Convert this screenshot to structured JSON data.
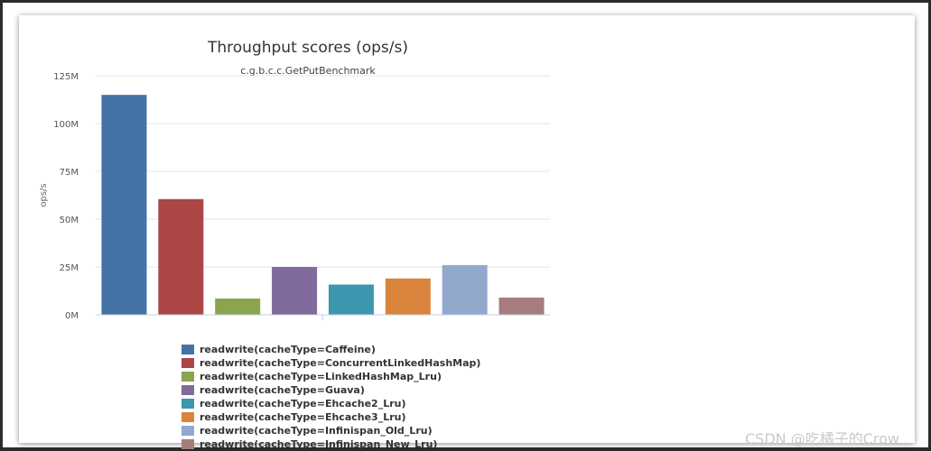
{
  "watermark": "CSDN @吃橘子的Crow",
  "chart_data": {
    "type": "bar",
    "title": "Throughput scores (ops/s)",
    "subtitle": "c.g.b.c.c.GetPutBenchmark",
    "xlabel": "",
    "ylabel": "ops/s",
    "ylim": [
      0,
      125000000
    ],
    "yticks": [
      0,
      25000000,
      50000000,
      75000000,
      100000000,
      125000000
    ],
    "ytick_labels": [
      "0M",
      "25M",
      "50M",
      "75M",
      "100M",
      "125M"
    ],
    "grid": true,
    "legend_position": "bottom",
    "series": [
      {
        "name": "readwrite(cacheType=Caffeine)",
        "value": 115000000,
        "color": "#4572a7"
      },
      {
        "name": "readwrite(cacheType=ConcurrentLinkedHashMap)",
        "value": 60500000,
        "color": "#aa4643"
      },
      {
        "name": "readwrite(cacheType=LinkedHashMap_Lru)",
        "value": 8500000,
        "color": "#89a54e"
      },
      {
        "name": "readwrite(cacheType=Guava)",
        "value": 25000000,
        "color": "#80699b"
      },
      {
        "name": "readwrite(cacheType=Ehcache2_Lru)",
        "value": 15800000,
        "color": "#3d96ae"
      },
      {
        "name": "readwrite(cacheType=Ehcache3_Lru)",
        "value": 19000000,
        "color": "#db843d"
      },
      {
        "name": "readwrite(cacheType=Infinispan_Old_Lru)",
        "value": 26000000,
        "color": "#92a8cd"
      },
      {
        "name": "readwrite(cacheType=Infinispan_New_Lru)",
        "value": 9000000,
        "color": "#a47d7c"
      }
    ]
  }
}
